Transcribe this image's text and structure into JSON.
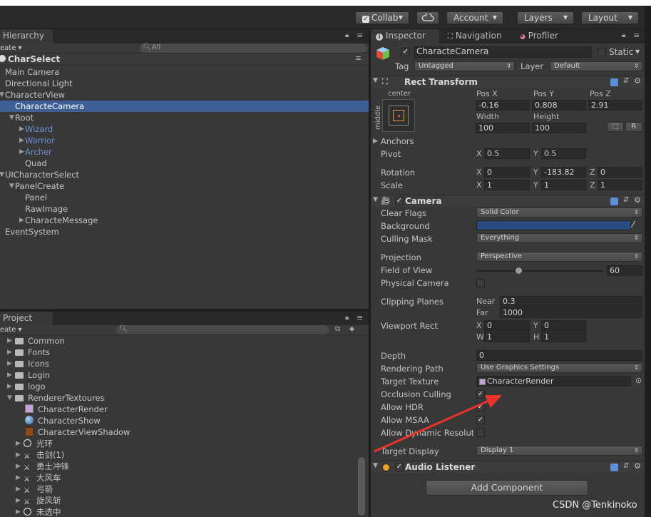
{
  "toolbar": {
    "collab": "Collab",
    "account": "Account",
    "layers": "Layers",
    "layout": "Layout"
  },
  "hierarchy": {
    "tab": "Hierarchy",
    "create": "eate",
    "search_placeholder": "All",
    "scene": "CharSelect",
    "items": [
      {
        "label": "Main Camera",
        "indent": 0,
        "arrow": "",
        "blue": false,
        "selected": false
      },
      {
        "label": "Directional Light",
        "indent": 0,
        "arrow": "",
        "blue": false,
        "selected": false
      },
      {
        "label": "CharacterView",
        "indent": 0,
        "arrow": "down",
        "blue": false,
        "selected": false
      },
      {
        "label": "CharacteCamera",
        "indent": 1,
        "arrow": "",
        "blue": false,
        "selected": true
      },
      {
        "label": "Root",
        "indent": 1,
        "arrow": "down",
        "blue": false,
        "selected": false
      },
      {
        "label": "Wizard",
        "indent": 2,
        "arrow": "right",
        "blue": true,
        "selected": false
      },
      {
        "label": "Warrior",
        "indent": 2,
        "arrow": "right",
        "blue": true,
        "selected": false
      },
      {
        "label": "Archer",
        "indent": 2,
        "arrow": "right",
        "blue": true,
        "selected": false
      },
      {
        "label": "Quad",
        "indent": 2,
        "arrow": "",
        "blue": false,
        "selected": false
      },
      {
        "label": "UICharacterSelect",
        "indent": 0,
        "arrow": "down",
        "blue": false,
        "selected": false
      },
      {
        "label": "PanelCreate",
        "indent": 1,
        "arrow": "down",
        "blue": false,
        "selected": false
      },
      {
        "label": "Panel",
        "indent": 2,
        "arrow": "",
        "blue": false,
        "selected": false
      },
      {
        "label": "RawImage",
        "indent": 2,
        "arrow": "",
        "blue": false,
        "selected": false
      },
      {
        "label": "CharacteMessage",
        "indent": 2,
        "arrow": "right",
        "blue": false,
        "selected": false
      },
      {
        "label": "EventSystem",
        "indent": 0,
        "arrow": "",
        "blue": false,
        "selected": false
      }
    ]
  },
  "project": {
    "tab": "Project",
    "create": "eate",
    "folders": [
      {
        "label": "Common",
        "indent": 0,
        "arrow": "right",
        "icon": "folder"
      },
      {
        "label": "Fonts",
        "indent": 0,
        "arrow": "right",
        "icon": "folder"
      },
      {
        "label": "Icons",
        "indent": 0,
        "arrow": "right",
        "icon": "folder"
      },
      {
        "label": "Login",
        "indent": 0,
        "arrow": "right",
        "icon": "folder"
      },
      {
        "label": "logo",
        "indent": 0,
        "arrow": "right",
        "icon": "folder"
      },
      {
        "label": "RendererTextoures",
        "indent": 0,
        "arrow": "down",
        "icon": "folder"
      },
      {
        "label": "CharacterRender",
        "indent": 1,
        "arrow": "",
        "icon": "render-texture"
      },
      {
        "label": "CharacterShow",
        "indent": 1,
        "arrow": "",
        "icon": "sphere"
      },
      {
        "label": "CharacterViewShadow",
        "indent": 1,
        "arrow": "",
        "icon": "shadow"
      },
      {
        "label": "光环",
        "indent": 0,
        "arrow": "right",
        "icon": "ring"
      },
      {
        "label": "击剑(1)",
        "indent": 0,
        "arrow": "right",
        "icon": "sprite"
      },
      {
        "label": "勇士冲锋",
        "indent": 0,
        "arrow": "right",
        "icon": "sprite"
      },
      {
        "label": "大风车",
        "indent": 0,
        "arrow": "right",
        "icon": "sprite"
      },
      {
        "label": "弓箭",
        "indent": 0,
        "arrow": "right",
        "icon": "sprite"
      },
      {
        "label": "旋风斩",
        "indent": 0,
        "arrow": "right",
        "icon": "sprite"
      },
      {
        "label": "未选中",
        "indent": 0,
        "arrow": "right",
        "icon": "ring"
      }
    ]
  },
  "inspector": {
    "tabs": [
      "Inspector",
      "Navigation",
      "Profiler"
    ],
    "object_name": "CharacteCamera",
    "static_label": "Static",
    "tag_label": "Tag",
    "tag_value": "Untagged",
    "layer_label": "Layer",
    "layer_value": "Default",
    "rect_transform": {
      "title": "Rect Transform",
      "anchor_h": "center",
      "anchor_v": "middle",
      "pos_x_label": "Pos X",
      "pos_y_label": "Pos Y",
      "pos_z_label": "Pos Z",
      "pos_x": "-0.16",
      "pos_y": "0.808",
      "pos_z": "2.91",
      "width_label": "Width",
      "height_label": "Height",
      "width": "100",
      "height": "100",
      "r_button": "R",
      "anchors": "Anchors",
      "pivot": "Pivot",
      "pivot_x": "0.5",
      "pivot_y": "0.5",
      "rotation": "Rotation",
      "rot_x": "0",
      "rot_y": "-183.82",
      "rot_z": "0",
      "scale": "Scale",
      "scale_x": "1",
      "scale_y": "1",
      "scale_z": "1"
    },
    "camera": {
      "title": "Camera",
      "clear_flags": "Clear Flags",
      "clear_flags_value": "Solid Color",
      "background": "Background",
      "background_color": "#2a4a80",
      "culling_mask": "Culling Mask",
      "culling_mask_value": "Everything",
      "projection": "Projection",
      "projection_value": "Perspective",
      "fov": "Field of View",
      "fov_value": "60",
      "fov_fraction": 0.33,
      "physical_camera": "Physical Camera",
      "clipping_planes": "Clipping Planes",
      "near_label": "Near",
      "near": "0.3",
      "far_label": "Far",
      "far": "1000",
      "viewport_rect": "Viewport Rect",
      "vp_x": "0",
      "vp_y": "0",
      "vp_w": "1",
      "vp_h": "1",
      "depth": "Depth",
      "depth_value": "0",
      "rendering_path": "Rendering Path",
      "rendering_path_value": "Use Graphics Settings",
      "target_texture": "Target Texture",
      "target_texture_value": "CharacterRender",
      "occlusion_culling": "Occlusion Culling",
      "allow_hdr": "Allow HDR",
      "allow_msaa": "Allow MSAA",
      "allow_dynamic": "Allow Dynamic Resoluti",
      "target_display": "Target Display",
      "target_display_value": "Display 1"
    },
    "audio_listener": "Audio Listener",
    "add_component": "Add Component"
  },
  "watermark": "CSDN @Tenkinoko",
  "colors": {
    "selection": "#3e5f96",
    "prefab_blue": "#6f8fd4",
    "annotation_red": "#e8342b"
  }
}
